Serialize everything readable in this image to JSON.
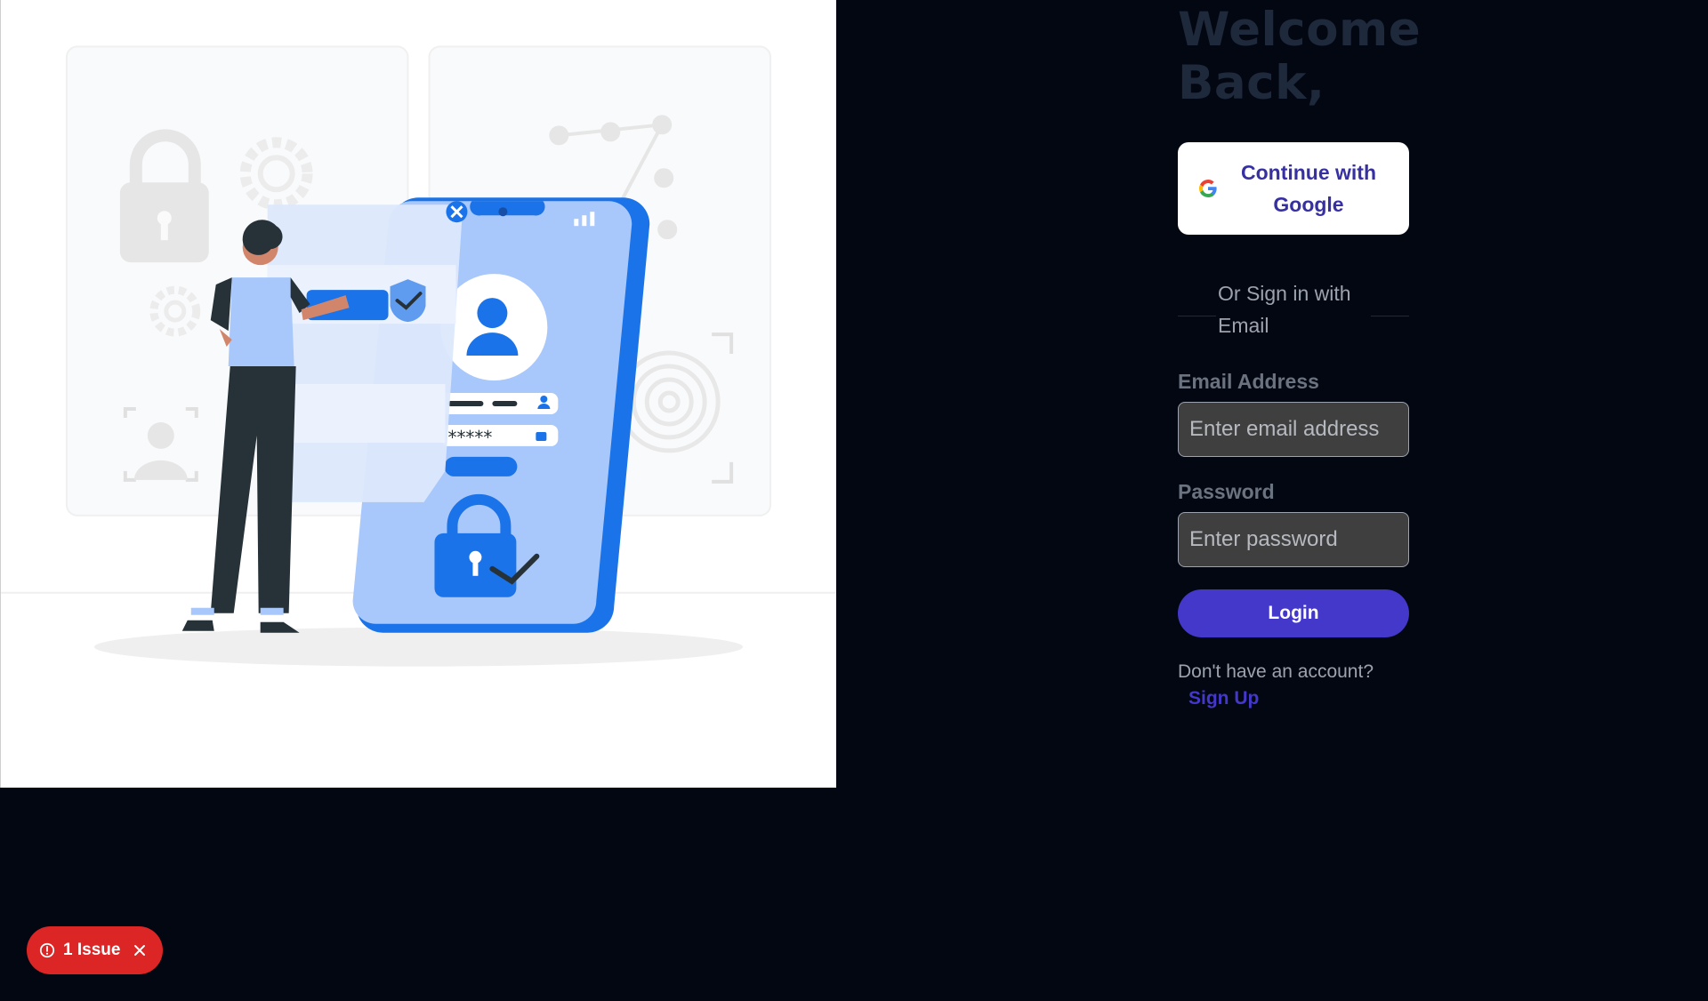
{
  "hero": {
    "title": "Welcome Back,"
  },
  "google_button": {
    "label": "Continue with Google",
    "icon": "google-g-icon"
  },
  "divider": {
    "text": "Or Sign in with Email"
  },
  "email": {
    "label": "Email Address",
    "placeholder": "Enter email address",
    "value": ""
  },
  "password": {
    "label": "Password",
    "placeholder": "Enter password",
    "value": ""
  },
  "login_button": {
    "label": "Login"
  },
  "signup": {
    "prompt": "Don't have an account?",
    "link_label": "Sign Up"
  },
  "issue_badge": {
    "label": "1 Issue",
    "icon": "alert-circle-icon",
    "close_icon": "close-icon"
  },
  "illustration": {
    "icon": "secure-login-illustration"
  },
  "colors": {
    "background": "#030712",
    "accent": "#4338ca",
    "google_text": "#3730a3",
    "input_bg": "#3f3f3f",
    "issue_red": "#dc2626",
    "illustration_blue": "#1a73e8"
  }
}
